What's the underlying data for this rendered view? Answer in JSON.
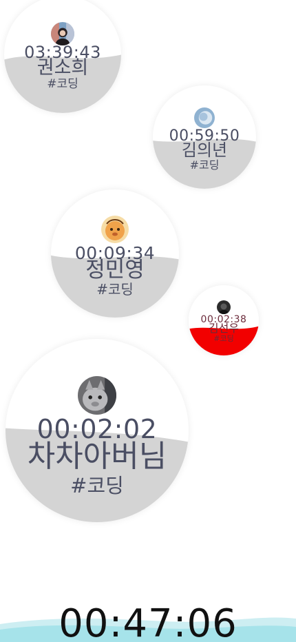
{
  "colors": {
    "fill_gray": "#d4d4d4",
    "fill_red": "#f20000",
    "text": "#4a4e63",
    "wave_light": "#cdeef2",
    "wave_dark": "#a6e3ea"
  },
  "participants": [
    {
      "time": "03:39:43",
      "name": "권소희",
      "tag": "#코딩",
      "fill_color": "#d4d4d4",
      "fill_level": 0.52,
      "avatar_icon": "profile-photo-icon"
    },
    {
      "time": "00:59:50",
      "name": "김의년",
      "tag": "#코딩",
      "fill_color": "#d4d4d4",
      "fill_level": 0.5,
      "avatar_icon": "profile-photo-icon"
    },
    {
      "time": "00:09:34",
      "name": "정민영",
      "tag": "#코딩",
      "fill_color": "#d4d4d4",
      "fill_level": 0.52,
      "avatar_icon": "cartoon-avatar-icon"
    },
    {
      "time": "00:02:38",
      "name": "김선우",
      "tag": "#코딩",
      "fill_color": "#f20000",
      "fill_level": 0.45,
      "avatar_icon": "profile-photo-icon"
    },
    {
      "time": "00:02:02",
      "name": "차차아버님",
      "tag": "#코딩",
      "fill_color": "#d4d4d4",
      "fill_level": 0.53,
      "avatar_icon": "cat-photo-icon"
    }
  ],
  "footer": {
    "total_time": "00:47:06"
  }
}
